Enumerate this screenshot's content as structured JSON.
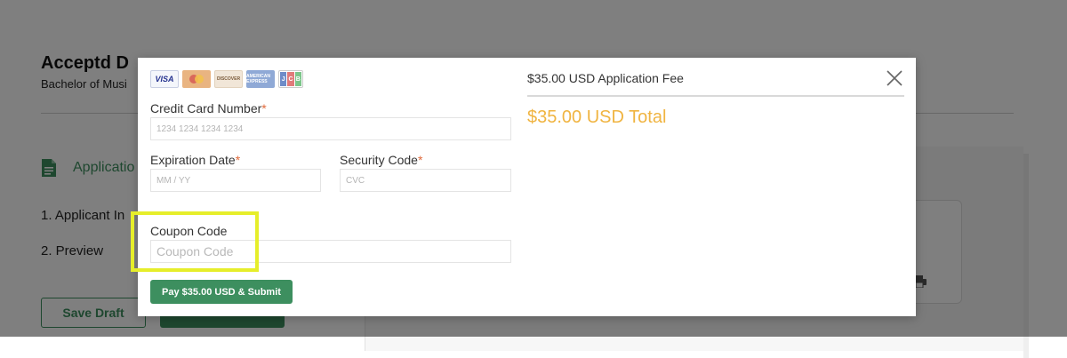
{
  "background": {
    "title": "Acceptd D",
    "subtitle": "Bachelor of Musi",
    "section_label": "Applicatio",
    "steps": [
      "1. Applicant In",
      "2. Preview"
    ],
    "save_draft_label": "Save Draft"
  },
  "modal": {
    "card_logos": [
      {
        "name": "visa",
        "text": "VISA"
      },
      {
        "name": "mastercard",
        "text": ""
      },
      {
        "name": "discover",
        "text": "DISCOVER"
      },
      {
        "name": "american-express",
        "text": "AMERICAN EXPRESS"
      },
      {
        "name": "jcb",
        "text": "JCB"
      }
    ],
    "card_number": {
      "label": "Credit Card Number",
      "required_mark": "*",
      "placeholder": "1234 1234 1234 1234"
    },
    "expiration": {
      "label": "Expiration Date",
      "required_mark": "*",
      "placeholder": "MM / YY"
    },
    "security_code": {
      "label": "Security Code",
      "required_mark": "*",
      "placeholder": "CVC"
    },
    "coupon": {
      "label": "Coupon Code",
      "placeholder": "Coupon Code"
    },
    "pay_button_label": "Pay $35.00 USD & Submit",
    "fee_header": "$35.00 USD Application Fee",
    "total": "$35.00 USD Total"
  },
  "colors": {
    "accent_green": "#3d8f5f",
    "total_orange": "#f0b441",
    "required_red": "#e06a3c",
    "highlight_yellow": "#e6ee2a"
  },
  "icons": [
    "document-icon",
    "printer-icon",
    "close-icon"
  ]
}
